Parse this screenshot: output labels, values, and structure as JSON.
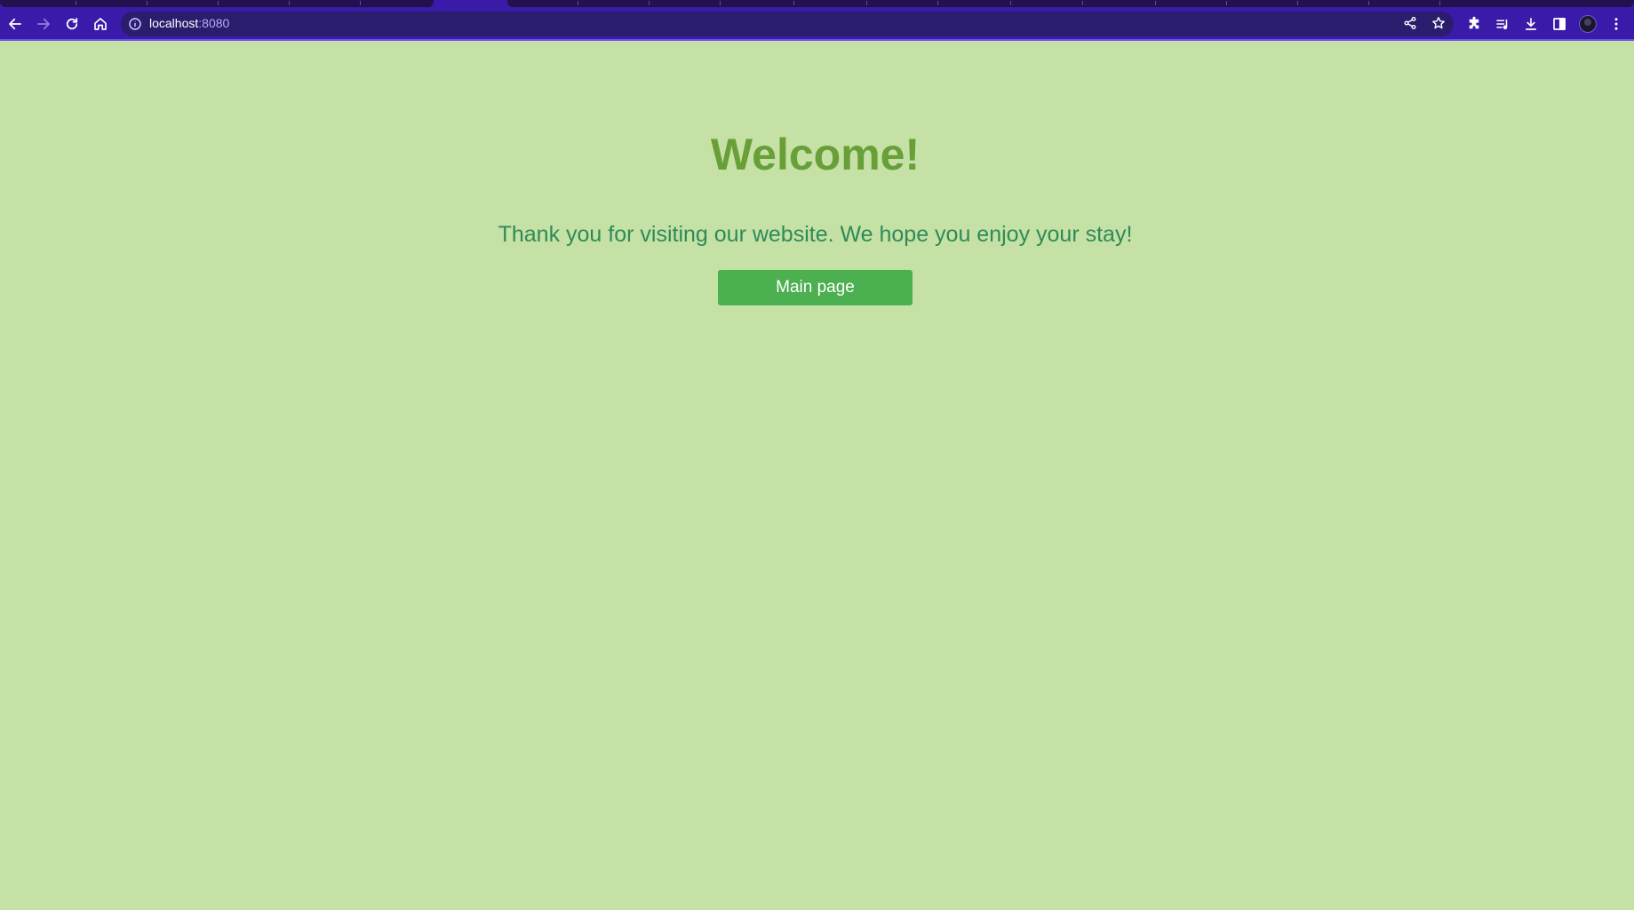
{
  "browser": {
    "url_host": "localhost",
    "url_port": ":8080"
  },
  "page": {
    "title": "Welcome!",
    "message": "Thank you for visiting our website. We hope you enjoy your stay!",
    "button_label": "Main page"
  },
  "colors": {
    "background": "#c5e1a5",
    "title": "#689f38",
    "message": "#2e8b57",
    "button": "#4caf50",
    "chrome": "#3a1aa8"
  },
  "icons": [
    "back-icon",
    "forward-icon",
    "reload-icon",
    "home-icon",
    "info-icon",
    "share-icon",
    "star-icon",
    "extensions-icon",
    "media-icon",
    "download-icon",
    "side-panel-icon",
    "avatar",
    "menu-icon"
  ]
}
